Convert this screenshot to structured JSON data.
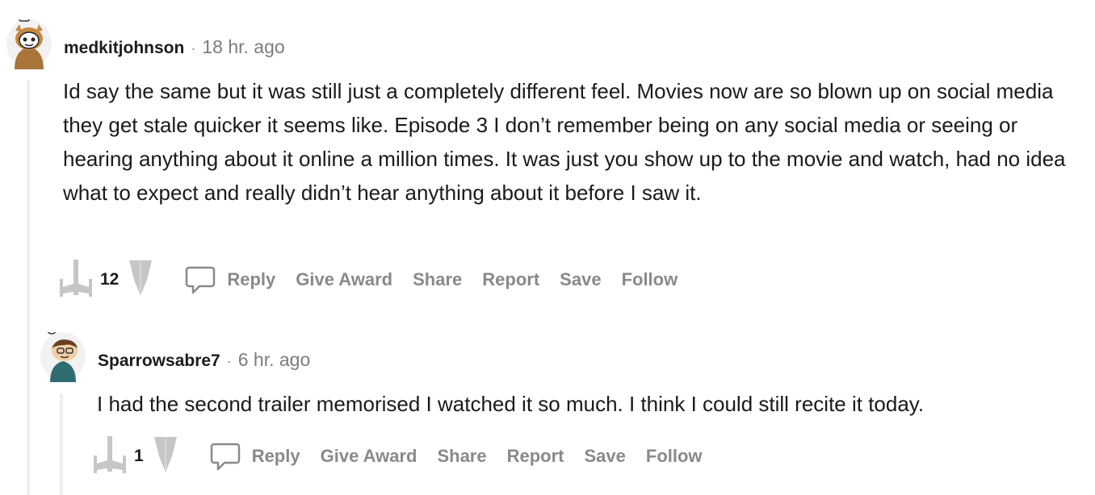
{
  "comments": [
    {
      "username": "medkitjohnson",
      "separator": "·",
      "time": "18 hr. ago",
      "body": "Id say the same but it was still just a completely different feel. Movies now are so blown up on social media they get stale quicker it seems like. Episode 3 I don’t remember being on any social media or seeing or hearing anything about it online a million times. It was just you show up to the movie and watch, had no idea what to expect and really didn’t hear anything about it before I saw it.",
      "score": "12",
      "actions": {
        "reply": "Reply",
        "give_award": "Give Award",
        "share": "Share",
        "report": "Report",
        "save": "Save",
        "follow": "Follow"
      }
    },
    {
      "username": "Sparrowsabre7",
      "separator": "·",
      "time": "6 hr. ago",
      "body": "I had the second trailer memorised I watched it so much. I think I could still recite it today.",
      "score": "1",
      "actions": {
        "reply": "Reply",
        "give_award": "Give Award",
        "share": "Share",
        "report": "Report",
        "save": "Save",
        "follow": "Follow"
      }
    }
  ],
  "icons": {
    "upvote": "x-wing-upvote-icon",
    "downvote": "tie-downvote-icon",
    "reply": "speech-bubble-icon"
  },
  "colors": {
    "action_gray": "#878a8c",
    "thread_line": "#edeff1",
    "text": "#1c1c1c"
  }
}
